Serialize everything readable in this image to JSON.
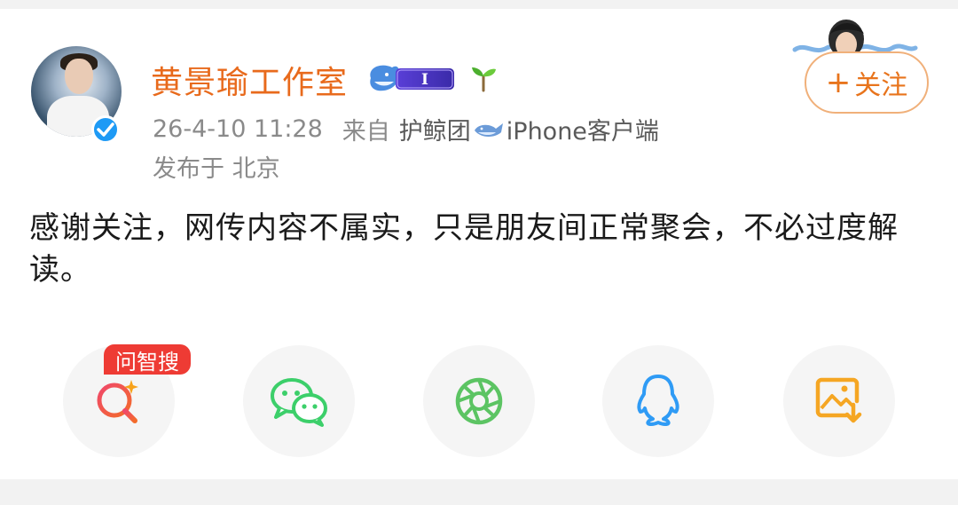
{
  "post": {
    "username": "黄景瑜工作室",
    "level_badge": "I",
    "timestamp": "26-4-10 11:28",
    "source_prefix": "来自",
    "source_app_1": "护鲸团",
    "source_app_2": "iPhone客户端",
    "location": "发布于 北京",
    "content": "感谢关注，网传内容不属实，只是朋友间正常聚会，不必过度解读。",
    "follow_plus": "+",
    "follow_label": "关注"
  },
  "share_bar": {
    "search_tag": "问智搜",
    "items": [
      {
        "icon": "ai-search-icon",
        "color": "#f04a3b"
      },
      {
        "icon": "wechat-icon",
        "color": "#3ccf6a"
      },
      {
        "icon": "moments-icon",
        "color": "#5cc463"
      },
      {
        "icon": "qq-icon",
        "color": "#2f9bf5"
      },
      {
        "icon": "save-image-icon",
        "color": "#f5a623"
      }
    ]
  },
  "colors": {
    "username": "#e86a1c",
    "follow_border": "#f0b07a",
    "verify": "#1e9af5",
    "tag": "#ee3b34"
  }
}
